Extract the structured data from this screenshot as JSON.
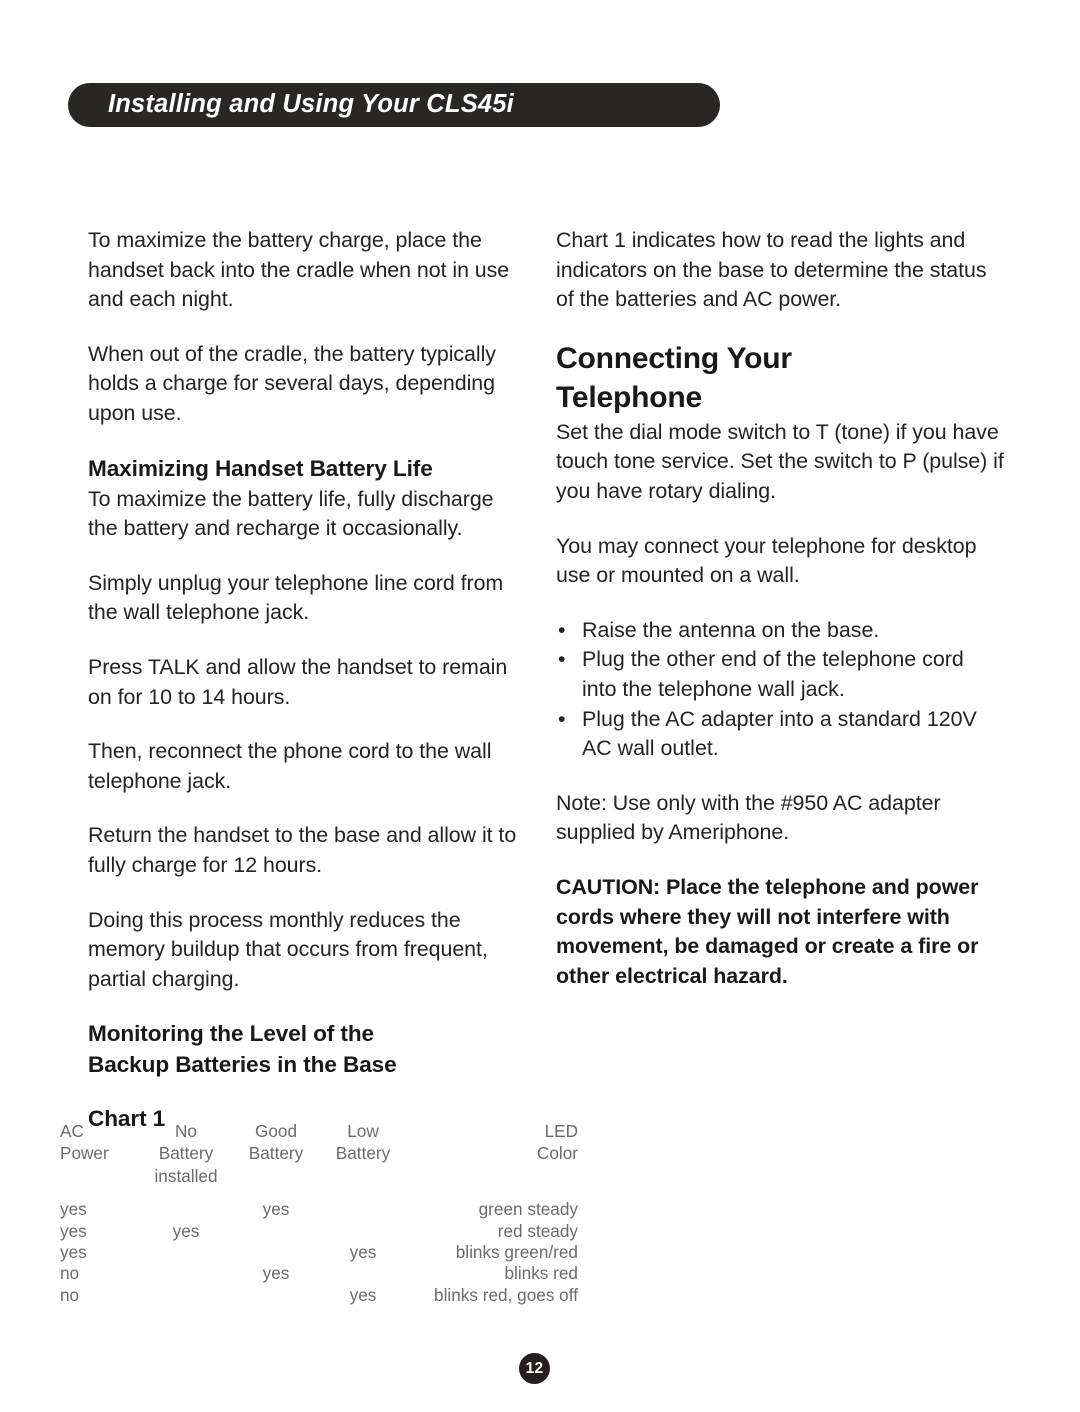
{
  "header": {
    "title": "Installing and Using Your CLS45i"
  },
  "left_column": {
    "p1": "To maximize the battery charge, place the handset back into the cradle when not in use and each night.",
    "p2": "When out of the cradle, the battery typically holds a charge for several days, depending upon use.",
    "h1": "Maximizing Handset Battery Life",
    "p3": "To maximize the battery life, fully discharge the battery and recharge it occasionally.",
    "p4": "Simply unplug your telephone line cord from the wall telephone jack.",
    "p5": "Press TALK and allow the handset to remain on for 10 to 14 hours.",
    "p6": "Then, reconnect the phone cord to the wall telephone jack.",
    "p7": "Return the handset to the base and allow it to fully charge for 12 hours.",
    "p8": "Doing this process monthly reduces the memory buildup that occurs from frequent, partial charging.",
    "h2_line1": "Monitoring the Level of the",
    "h2_line2": "Backup Batteries in the Base",
    "h3": "Chart 1"
  },
  "right_column": {
    "p1": "Chart 1 indicates how to read the lights and indicators on the base to determine the status of the batteries and AC power.",
    "big_head_line1": "Connecting Your",
    "big_head_line2": "Telephone",
    "p2": "Set the dial mode switch to T (tone) if you have touch tone service. Set the switch to P (pulse) if you have rotary dialing.",
    "p3": "You may connect your telephone for desktop use or mounted on a wall.",
    "bullet_char": "•",
    "bullets": [
      "Raise the antenna on the base.",
      "Plug the other end of the telephone cord into the telephone wall jack.",
      "Plug the AC adapter into a standard 120V AC wall outlet."
    ],
    "note": "Note: Use only with the #950 AC adapter supplied by Ameriphone.",
    "caution": "CAUTION: Place the telephone and power cords where they will not interfere with movement, be damaged or create a fire or other electrical hazard."
  },
  "chart_data": {
    "type": "table",
    "title": "Chart 1",
    "headers": [
      [
        "AC",
        "Power",
        ""
      ],
      [
        "No",
        "Battery",
        "installed"
      ],
      [
        "Good",
        "Battery",
        ""
      ],
      [
        "Low",
        "Battery",
        ""
      ],
      [
        "LED",
        "Color",
        ""
      ]
    ],
    "rows": [
      [
        "yes",
        "",
        "yes",
        "",
        "green steady"
      ],
      [
        "yes",
        "yes",
        "",
        "",
        "red steady"
      ],
      [
        "yes",
        "",
        "",
        "yes",
        "blinks green/red"
      ],
      [
        "no",
        "",
        "yes",
        "",
        "blinks red"
      ],
      [
        "no",
        "",
        "",
        "yes",
        "blinks red, goes off"
      ]
    ]
  },
  "footer": {
    "page_number": "12"
  },
  "colors": {
    "header_pill": "#2b2626",
    "body_text": "#262222",
    "table_text": "#6f6a6a",
    "page_badge": "#241f1f",
    "background": "#ffffff"
  }
}
